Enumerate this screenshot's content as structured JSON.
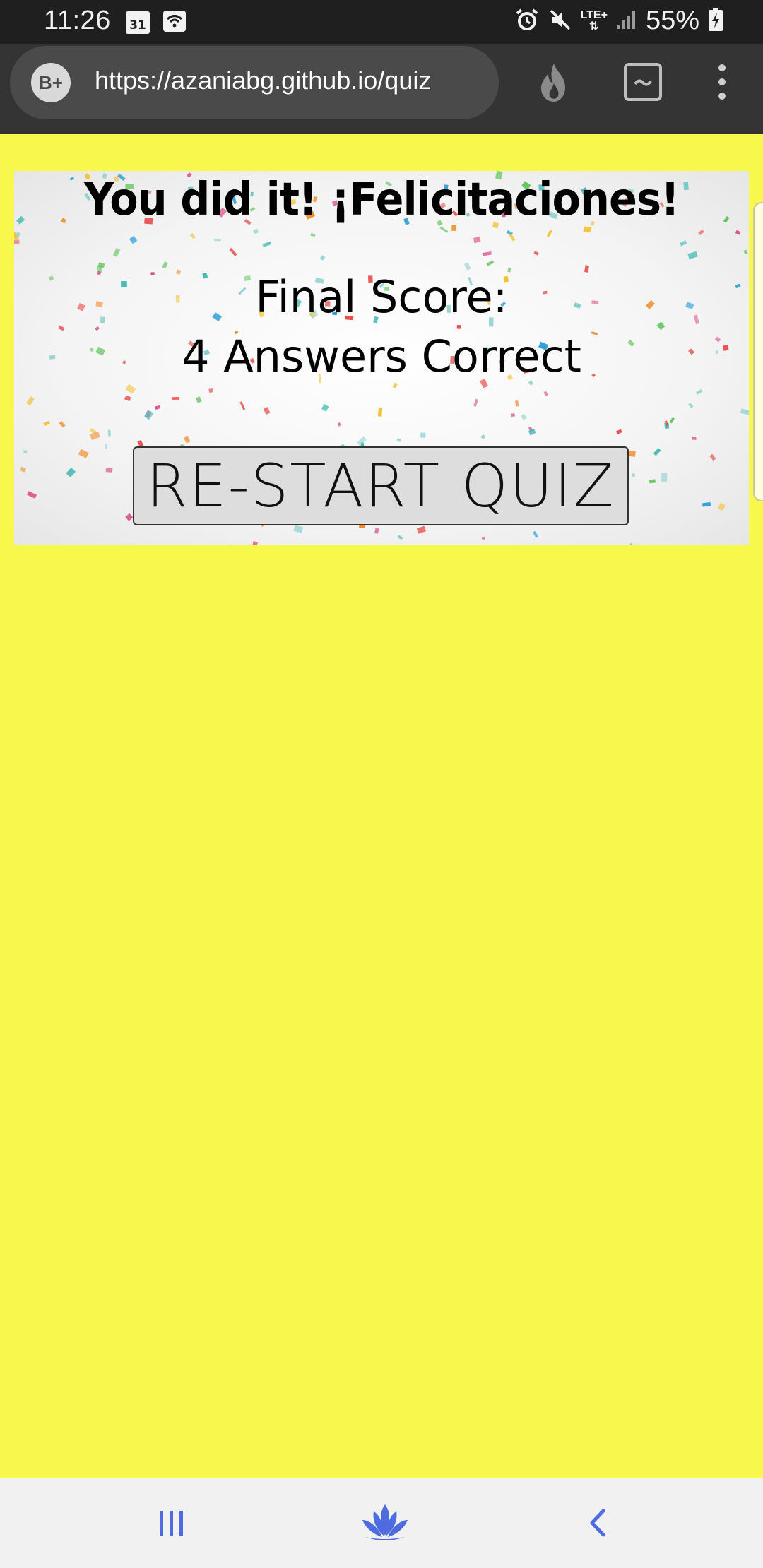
{
  "status_bar": {
    "time": "11:26",
    "calendar_day": "31",
    "network_label": "LTE+",
    "battery_percent": "55%"
  },
  "browser": {
    "site_badge": "B+",
    "url": "https://azaniabg.github.io/quiz",
    "icons": [
      "flame-icon",
      "tab-switcher-icon",
      "overflow-menu-icon"
    ]
  },
  "quiz_result": {
    "heading": "You did it! ¡Felicitaciones!",
    "score_label": "Final Score:",
    "score_value": "4 Answers Correct",
    "restart_label": "RE-START QUIZ"
  },
  "nav_bar": {
    "buttons": [
      "recent-apps-icon",
      "home-icon",
      "back-icon"
    ]
  },
  "colors": {
    "page_background": "#f7f84b",
    "status_bar": "#1f1f1f",
    "browser_bar": "#343434",
    "url_pill": "#4a4a4a",
    "button_background": "#dddddd",
    "nav_icon": "#4e6ce0"
  }
}
